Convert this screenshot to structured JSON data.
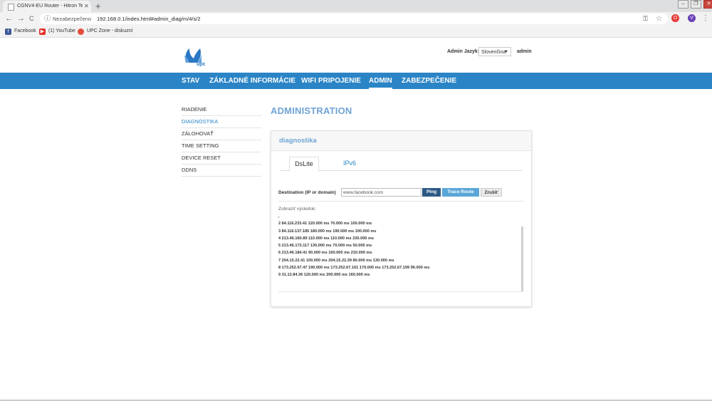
{
  "browser": {
    "tab_title": "CGNV4-EU Router - Hitron Techn",
    "tab_close": "✕",
    "new_tab": "+",
    "insecure_label": "Nezabezpečeno",
    "url": "192.168.0.1/index.html#admin_diag/m/4/s/2",
    "bookmarks": [
      "Facebook",
      "(1) YouTube",
      "UPC Zone - diskuzní"
    ],
    "extensions": [
      {
        "label": "O",
        "color": "#e53935"
      },
      {
        "label": "V",
        "color": "#6a3fb5"
      }
    ],
    "nav_back": "←",
    "nav_forward": "→",
    "nav_reload": "C",
    "menu": "⋮"
  },
  "header": {
    "logo_text": "upc",
    "admin_language_label": "Admin Jazyk:",
    "language_selected": "Slovenčina",
    "user": "admin"
  },
  "menu": [
    "STAV",
    "ZÁKLADNÉ INFORMÁCIE",
    "WIFI PRIPOJENIE",
    "ADMIN",
    "ZABEZPEČENIE"
  ],
  "menu_active": "ADMIN",
  "sidebar": [
    "RIADENIE",
    "DIAGNOSTIKA",
    "ZÁLOHOVAŤ",
    "TIME SETTING",
    "DEVICE RESET",
    "DDNS"
  ],
  "sidebar_active": "DIAGNOSTIKA",
  "page_title": "ADMINISTRATION",
  "panel": {
    "title": "diagnostika",
    "tabs": [
      "DsLite",
      "IPv6"
    ],
    "destination_label": "Destination (IP or domain)",
    "destination_value": "www.facebook.com",
    "ping_button": "Ping",
    "trace_button": "Trace Route",
    "cancel_button": "Zrušiť",
    "result_label": "Zobraziť výsledok:",
    "results": [
      ",",
      "2 84.116.233.41 120.000 ms 70.000 ms 100.000 ms",
      "3 84.116.137.185 180.000 ms 190.000 ms 100.000 ms",
      "4 213.46.160.89 110.000 ms 110.000 ms 230.000 ms",
      "5 213.46.173.117 130.000 ms 70.000 ms 50.000 ms",
      "6 213.46.184.41 90.000 ms 160.000 ms 210.000 ms",
      "7 204.15.22.41 100.000 ms 204.15.22.39 80.000 ms 130.000 ms",
      "8 173.252.67.47 190.000 ms 173.252.67.161 170.000 ms 173.252.67.199 90.000 ms",
      "9 31.13.84.36 120.000 ms 200.000 ms 160.000 ms"
    ]
  },
  "colors": {
    "menubar": "#2a84c6",
    "accent_title": "#6fa3d6",
    "ping_button": "#2c5a86",
    "trace_button": "#5aa6d8"
  }
}
